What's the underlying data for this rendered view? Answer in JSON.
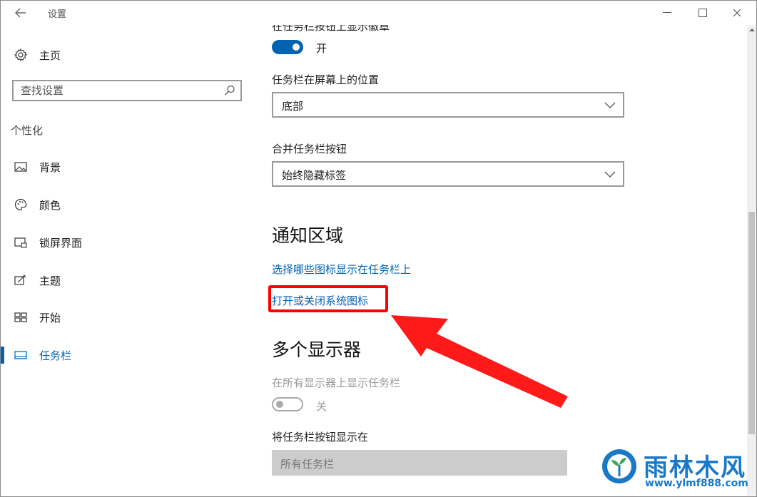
{
  "window": {
    "title": "设置"
  },
  "sidebar": {
    "home_label": "主页",
    "search_placeholder": "查找设置",
    "section_label": "个性化",
    "items": [
      {
        "label": "背景",
        "icon": "image-icon"
      },
      {
        "label": "颜色",
        "icon": "palette-icon"
      },
      {
        "label": "锁屏界面",
        "icon": "lock-screen-icon"
      },
      {
        "label": "主题",
        "icon": "theme-icon"
      },
      {
        "label": "开始",
        "icon": "start-icon"
      },
      {
        "label": "任务栏",
        "icon": "taskbar-icon",
        "active": true
      }
    ]
  },
  "content": {
    "cut_label": "在任务栏按钮上显示徽章",
    "badge_toggle": {
      "state": "开",
      "on": true
    },
    "position": {
      "label": "任务栏在屏幕上的位置",
      "value": "底部"
    },
    "combine": {
      "label": "合并任务栏按钮",
      "value": "始终隐藏标签"
    },
    "notification_area": {
      "heading": "通知区域",
      "link_choose_icons": "选择哪些图标显示在任务栏上",
      "link_system_icons": "打开或关闭系统图标"
    },
    "multi_display": {
      "heading": "多个显示器",
      "show_all_label": "在所有显示器上显示任务栏",
      "show_all_toggle": {
        "state": "关",
        "on": false
      },
      "buttons_on_label": "将任务栏按钮显示在",
      "buttons_on_value": "所有任务栏"
    }
  },
  "watermark": {
    "name": "雨林木风",
    "url": "www.ylmf888.com"
  },
  "colors": {
    "accent": "#0063b1",
    "annotation": "#ff0000",
    "watermark": "#1a78c8"
  }
}
